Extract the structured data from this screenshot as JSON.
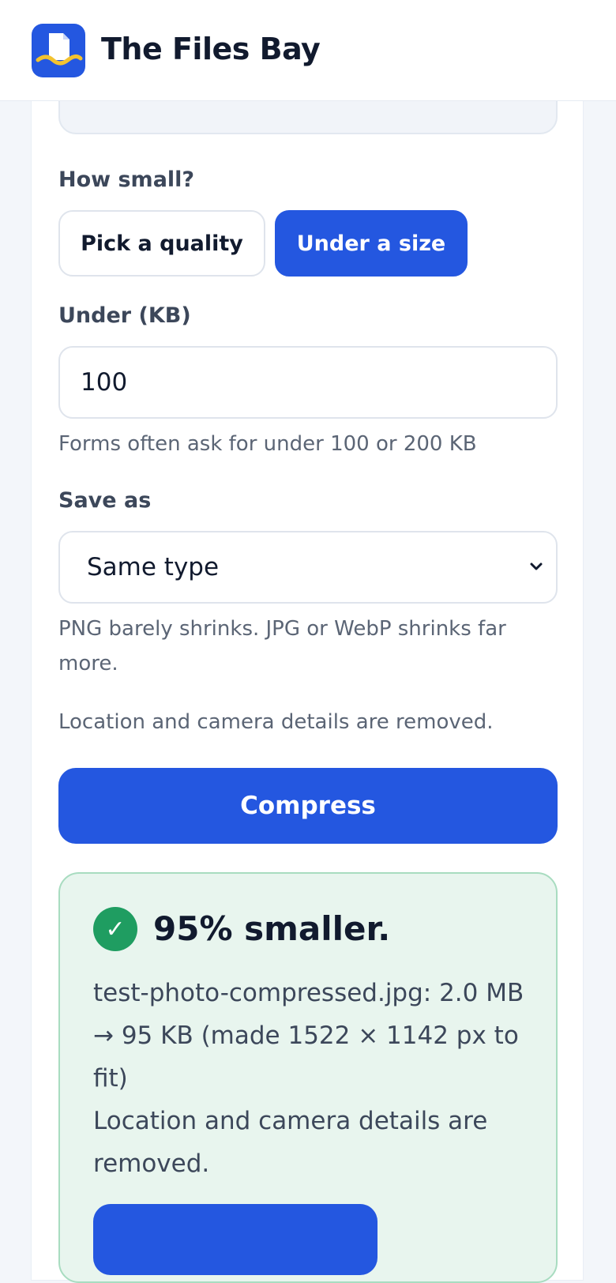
{
  "header": {
    "brand": "The Files Bay"
  },
  "mode": {
    "label": "How small?",
    "options": [
      "Pick a quality",
      "Under a size"
    ],
    "selected": "Under a size"
  },
  "size_limit": {
    "label": "Under (KB)",
    "value": "100",
    "hint": "Forms often ask for under 100 or 200 KB"
  },
  "save_as": {
    "label": "Save as",
    "selected": "Same type",
    "hint": "PNG barely shrinks. JPG or WebP shrinks far more."
  },
  "privacy_note": "Location and camera details are removed.",
  "compress_button": "Compress",
  "result": {
    "headline": "95% smaller.",
    "detail": "test-photo-compressed.jpg: 2.0 MB → 95 KB (made 1522 × 1142 px to fit)",
    "privacy": "Location and camera details are removed."
  },
  "colors": {
    "accent": "#2457e0",
    "success": "#1f9d61",
    "success_bg": "#e8f5ee"
  }
}
